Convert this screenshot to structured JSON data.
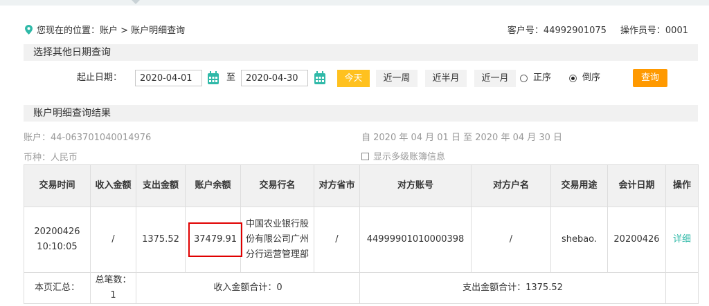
{
  "location": {
    "text": "您现在的位置：账户 > 账户明细查询"
  },
  "customer": {
    "id_text": "客户号：44992901075",
    "operator_text": "操作员号：0001"
  },
  "sections": {
    "date_query": "选择其他日期查询",
    "result": "账户明细查询结果"
  },
  "date_filter": {
    "label": "起止日期：",
    "start": "2020-04-01",
    "separator": "至",
    "end": "2020-04-30",
    "quick": [
      "今天",
      "近一周",
      "近半月",
      "近一月"
    ],
    "sort_asc": "正序",
    "sort_desc": "倒序",
    "sort_selected": "desc",
    "search": "查询"
  },
  "account": {
    "number_text": "账户：44-063701040014976",
    "currency_text": "币种：人民币",
    "range_text": "自 2020 年 04 月 01 日 至 2020 年 04 月 30 日",
    "multi_ledger": "显示多级账簿信息"
  },
  "table": {
    "headers": [
      "交易时间",
      "收入金额",
      "支出金额",
      "账户余额",
      "交易行名",
      "对方省市",
      "对方账号",
      "对方户名",
      "交易用途",
      "会计日期",
      "操作"
    ],
    "row": {
      "time_date": "20200426",
      "time_clock": "10:10:05",
      "income": "/",
      "expense": "1375.52",
      "balance": "37479.91",
      "bank_name": "中国农业银行股份有限公司广州分行运营管理部",
      "province": "/",
      "counter_account": "44999901010000398",
      "counter_name": "/",
      "purpose": "shebao.",
      "account_date": "20200426",
      "action": "详细"
    },
    "summary": {
      "label": "本页汇总：",
      "count": "总笔数：1",
      "income_total": "收入金额合计：0",
      "expense_total": "支出金额合计：1375.52"
    }
  },
  "colors": {
    "accent_orange": "#ff9900",
    "today_yellow": "#ffc11f",
    "link_teal": "#2fb9a8",
    "highlight_red": "#e00000",
    "calendar_teal": "#2fb9a8"
  }
}
